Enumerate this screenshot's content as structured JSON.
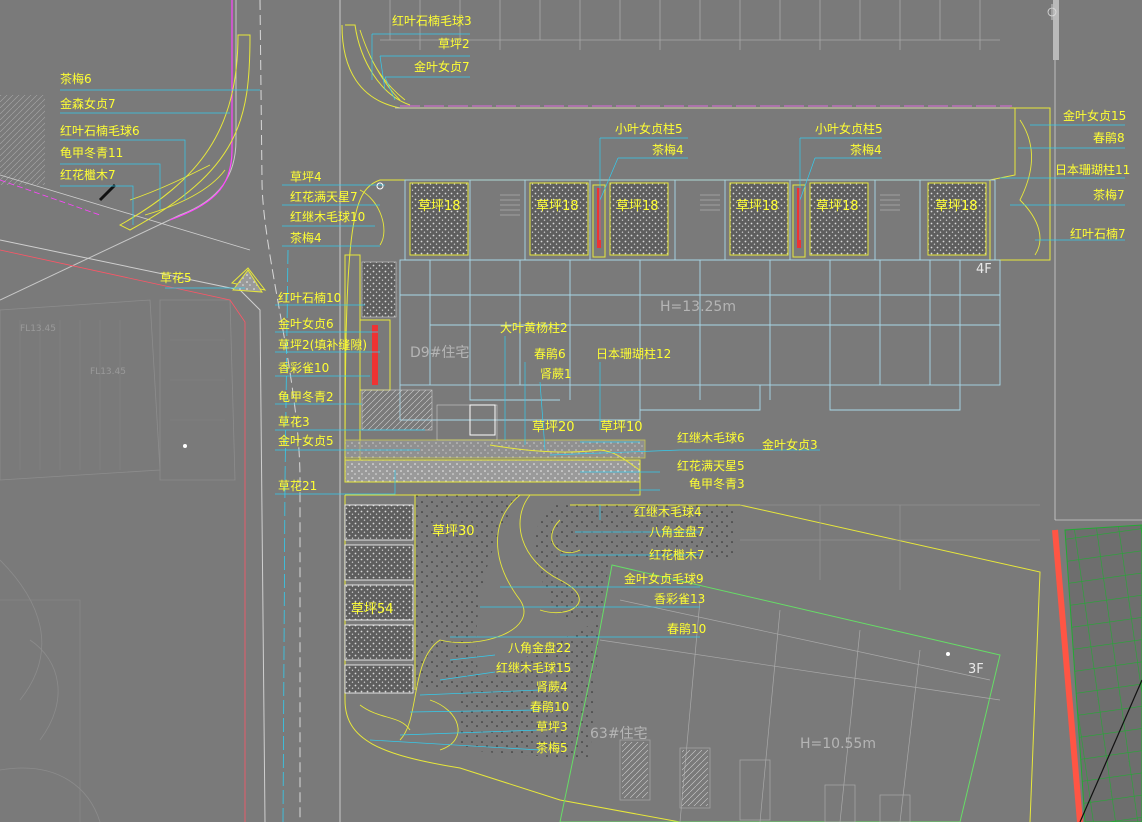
{
  "labels": {
    "l01": "红叶石楠毛球3",
    "l02": "草坪2",
    "l03": "金叶女贞7",
    "l04": "茶梅6",
    "l05": "金森女贞7",
    "l06": "红叶石楠毛球6",
    "l07": "龟甲冬青11",
    "l08": "红花檵木7",
    "l09": "小叶女贞柱5",
    "l10": "茶梅4",
    "l11": "小叶女贞柱5",
    "l12": "茶梅4",
    "l13": "金叶女贞15",
    "l14": "春鹃8",
    "l15": "日本珊瑚柱11",
    "l16": "茶梅7",
    "l17": "红叶石楠7",
    "l18": "草坪4",
    "l19": "红花满天星7",
    "l20": "红继木毛球10",
    "l21": "茶梅4",
    "l22": "草坪18",
    "l23": "草坪18",
    "l24": "草坪18",
    "l25": "草坪18",
    "l26": "草坪18",
    "l27": "草坪18",
    "l28": "草花5",
    "l29": "红叶石楠10",
    "l30": "金叶女贞6",
    "l31": "草坪2(填补缝隙)",
    "l32": "香彩雀10",
    "l33": "龟甲冬青2",
    "l34": "草花3",
    "l35": "金叶女贞5",
    "l36": "草花21",
    "l37": "大叶黄杨柱2",
    "l38": "春鹃6",
    "l39": "肾蕨1",
    "l40": "日本珊瑚柱12",
    "l41": "草坪20",
    "l42": "草坪10",
    "l43": "红继木毛球6",
    "l44": "金叶女贞3",
    "l45": "红花满天星5",
    "l46": "龟甲冬青3",
    "l47": "红继木毛球4",
    "l48": "八角金盘7",
    "l49": "红花檵木7",
    "l50": "金叶女贞毛球9",
    "l51": "香彩雀13",
    "l52": "春鹃10",
    "l53": "草坪30",
    "l54": "草坪54",
    "l55": "八角金盘22",
    "l56": "红继木毛球15",
    "l57": "肾蕨4",
    "l58": "春鹃10",
    "l59": "草坪3",
    "l60": "茶梅5"
  },
  "building_labels": {
    "height_top": "H=13.25m",
    "d9": "D9#住宅",
    "floors_4f": "4F",
    "b63": "63#住宅",
    "height_bottom": "H=10.55m",
    "floors_3f": "3F",
    "small_a": "FL13.45",
    "small_b": "FL13.45"
  },
  "colors": {
    "background": "#7a7a7a",
    "label_text": "#ffff33",
    "leader_line": "#33ccee",
    "planting_boundary": "#e8e83a",
    "building_outline": "#a8d8e8",
    "lawn_hatch": "#c8c8c8",
    "property_line": "#ff4466",
    "green_grid": "#22aa33"
  },
  "icons": [
    "north-arrow-icon"
  ]
}
